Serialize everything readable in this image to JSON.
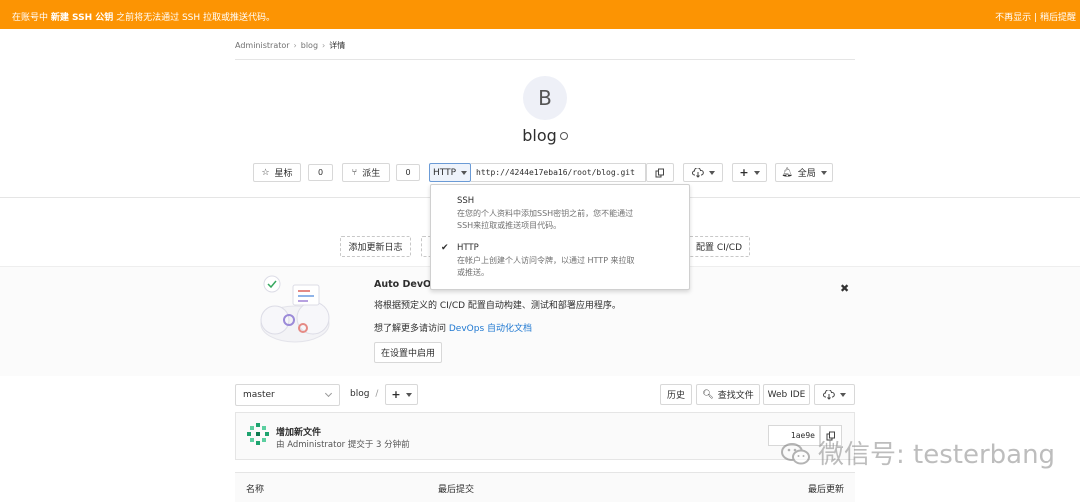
{
  "banner": {
    "msg_prefix": "在账号中 ",
    "msg_bold": "新建 SSH 公钥",
    "msg_suffix": " 之前将无法通过 SSH 拉取或推送代码。",
    "dismiss": "不再显示",
    "separator": "|",
    "remind_later": "稍后提醒",
    "color": "#fc9403"
  },
  "breadcrumb": {
    "items": [
      "Administrator",
      "blog",
      "详情"
    ],
    "separator": "›"
  },
  "project": {
    "avatar_letter": "B",
    "name": "blog"
  },
  "actions": {
    "star_label": "星标",
    "star_count": "0",
    "fork_label": "派生",
    "fork_count": "0",
    "protocol": "HTTP",
    "clone_url": "http://4244e17eba16/root/blog.git",
    "notification_label": "全局"
  },
  "clone_dropdown": {
    "ssh_title": "SSH",
    "ssh_desc_1": "在您的个人资料中添加SSH密钥之前，您不能通过",
    "ssh_desc_2": "SSH来拉取或推送项目代码。",
    "http_title": "HTTP",
    "http_desc_1": "在帐户上创建个人访问令牌，以通过 HTTP 来拉取",
    "http_desc_2": "或推送。",
    "selected": "HTTP"
  },
  "quick_links": {
    "changelog": "添加更新日志",
    "cicd": "配置 CI/CD"
  },
  "auto_devops": {
    "title": "Auto DevOps",
    "desc": "将根据预定义的 CI/CD 配置自动构建、测试和部署应用程序。",
    "more_prefix": "想了解更多请访问 ",
    "more_link": "DevOps 自动化文档",
    "enable_button": "在设置中启用"
  },
  "repo": {
    "branch": "master",
    "path_root": "blog",
    "path_sep": "/",
    "history": "历史",
    "find_file": "查找文件",
    "web_ide": "Web IDE"
  },
  "last_commit": {
    "title": "增加新文件",
    "by": "由 ",
    "author": "Administrator",
    "time": " 提交于 3 分钟前",
    "sha": "1ae9e"
  },
  "table": {
    "col_name": "名称",
    "col_last_commit": "最后提交",
    "col_last_update": "最后更新"
  },
  "watermark": {
    "text": "微信号: testerbang"
  }
}
